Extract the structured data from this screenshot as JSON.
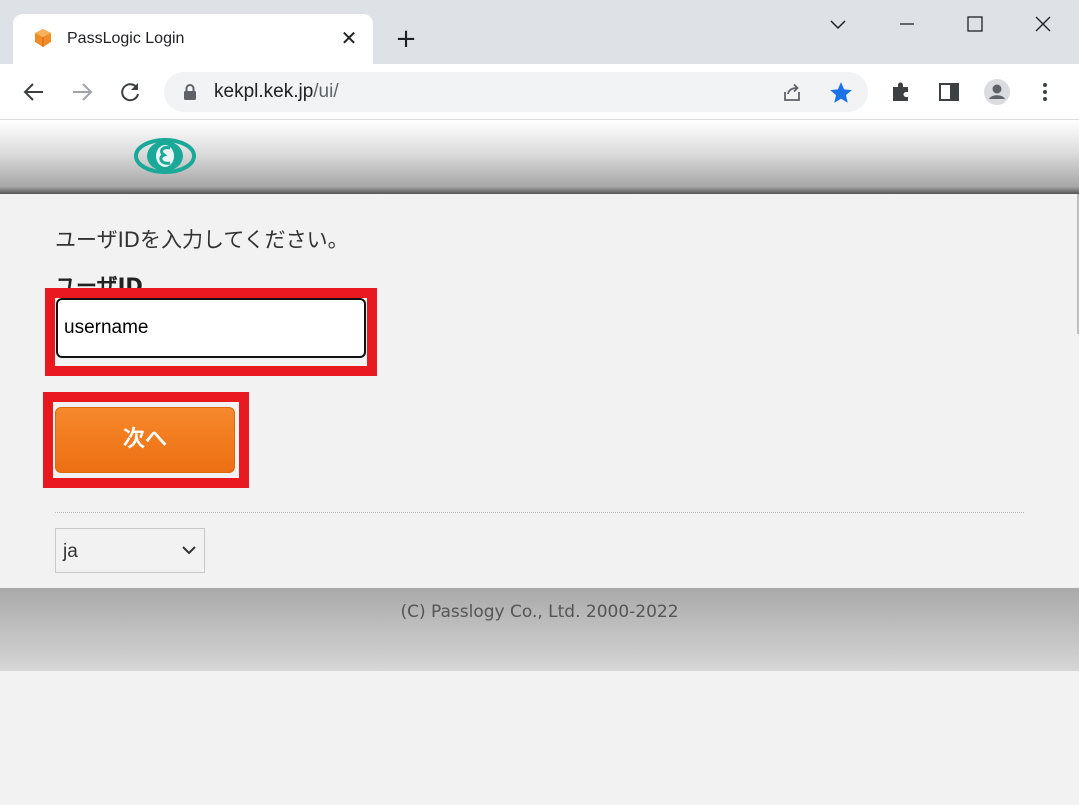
{
  "browser": {
    "tab_title": "PassLogic Login",
    "url_host": "kekpl.kek.jp",
    "url_path": "/ui/"
  },
  "page": {
    "prompt": "ユーザIDを入力してください。",
    "user_id_label": "ユーザID",
    "user_id_value": "username",
    "next_button": "次へ",
    "language_selected": "ja",
    "copyright": "(C) Passlogy Co., Ltd. 2000-2022"
  },
  "colors": {
    "highlight": "#e8191f",
    "button_orange": "#f0781a",
    "star_blue": "#1a73e8",
    "logo_teal": "#1aa898"
  },
  "icons": {
    "favicon": "orange-cube-icon",
    "close": "close-icon",
    "new_tab": "plus-icon",
    "back": "back-arrow-icon",
    "forward": "forward-arrow-icon",
    "reload": "reload-icon",
    "lock": "lock-icon",
    "share": "share-icon",
    "bookmark": "star-icon",
    "extensions": "puzzle-icon",
    "side_panel": "side-panel-icon",
    "profile": "profile-icon",
    "menu": "kebab-menu-icon"
  }
}
